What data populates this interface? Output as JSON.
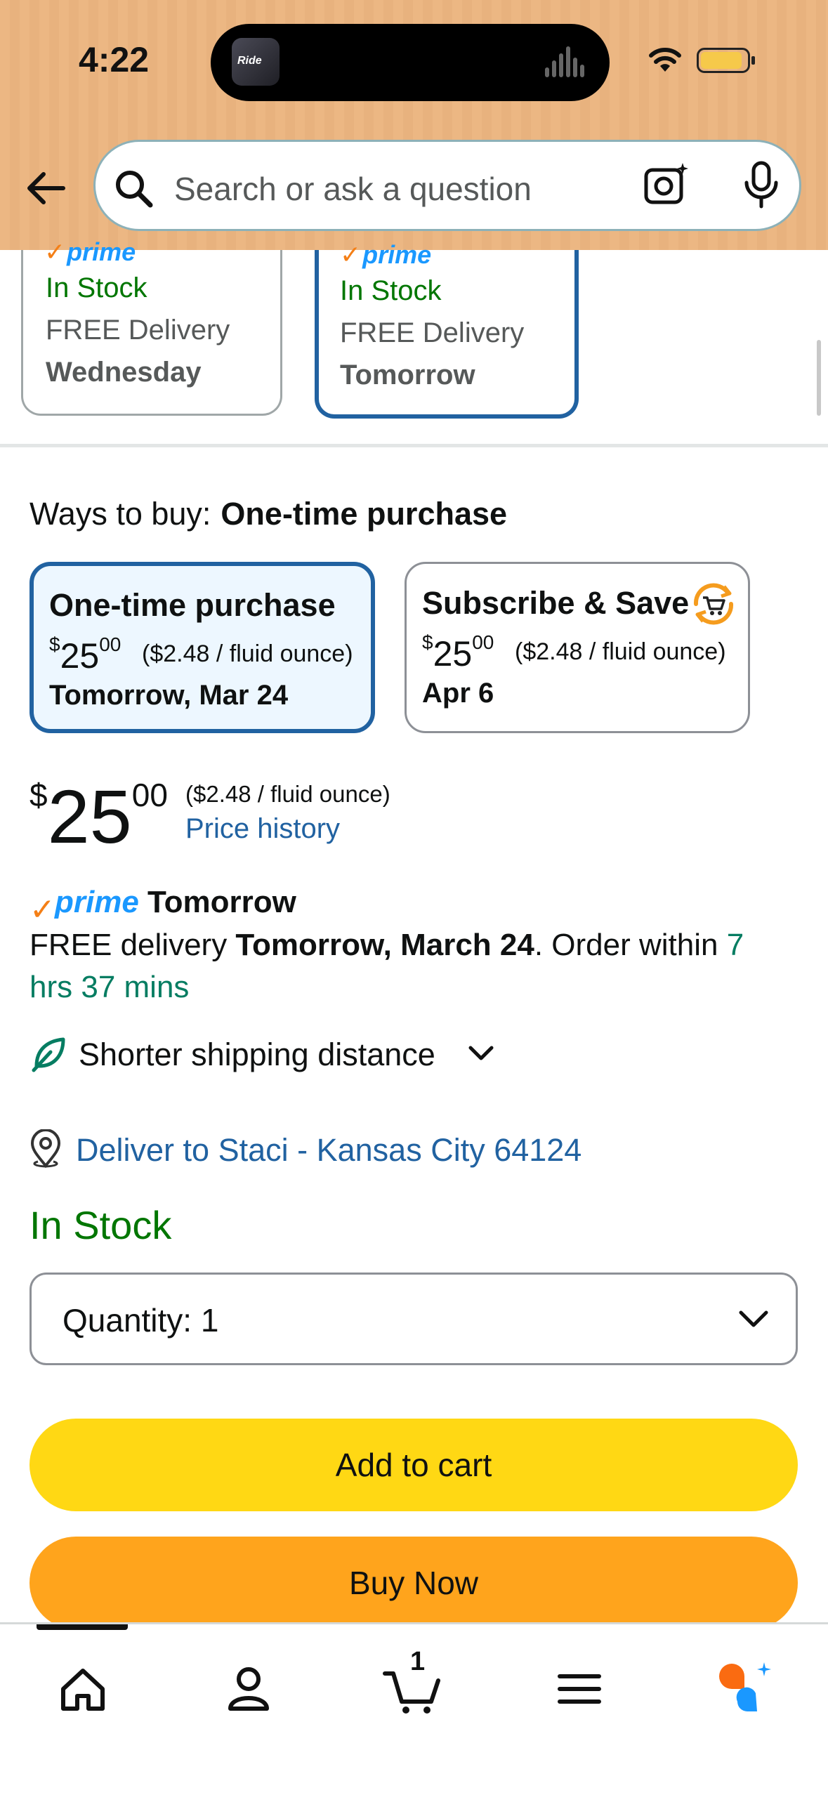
{
  "status_bar": {
    "time": "4:22",
    "island_thumb_text": "Ride"
  },
  "search": {
    "placeholder": "Search or ask a question"
  },
  "offers": [
    {
      "prime": "prime",
      "stock": "In Stock",
      "free": "FREE Delivery",
      "day": "Wednesday",
      "selected": false
    },
    {
      "prime": "prime",
      "stock": "In Stock",
      "free": "FREE Delivery",
      "day": "Tomorrow",
      "selected": true
    }
  ],
  "ways_to_buy": {
    "label": "Ways to buy:",
    "selected": "One-time purchase",
    "options": [
      {
        "title": "One-time purchase",
        "price_dollar": "$",
        "price_whole": "25",
        "price_cents": "00",
        "unit": "($2.48 / fluid ounce)",
        "date": "Tomorrow, Mar 24"
      },
      {
        "title": "Subscribe & Save",
        "price_dollar": "$",
        "price_whole": "25",
        "price_cents": "00",
        "unit": "($2.48 / fluid ounce)",
        "date": "Apr 6"
      }
    ]
  },
  "price": {
    "currency": "$",
    "whole": "25",
    "cents": "00",
    "unit": "($2.48 / fluid ounce)",
    "history_link": "Price history"
  },
  "delivery": {
    "prime": "prime",
    "prime_speed": "Tomorrow",
    "prefix": "FREE delivery ",
    "date": "Tomorrow, March 24",
    "middle": ". Order within ",
    "countdown": "7 hrs 37 mins",
    "shipping_note": "Shorter shipping distance",
    "deliver_to": "Deliver to Staci - Kansas City 64124"
  },
  "stock_status": "In Stock",
  "quantity": {
    "label": "Quantity:",
    "value": "1"
  },
  "buttons": {
    "add_to_cart": "Add to cart",
    "buy_now": "Buy Now"
  },
  "nav": {
    "cart_count": "1",
    "items": [
      "home-icon",
      "account-icon",
      "cart-icon",
      "menu-icon",
      "rufus-icon"
    ]
  },
  "colors": {
    "header_bg": "#ecb783",
    "link": "#2162a1",
    "in_stock": "#007600",
    "add_to_cart": "#ffd814",
    "buy_now": "#ffa41c",
    "prime_blue": "#1a98ff",
    "prime_orange": "#f47f16"
  }
}
